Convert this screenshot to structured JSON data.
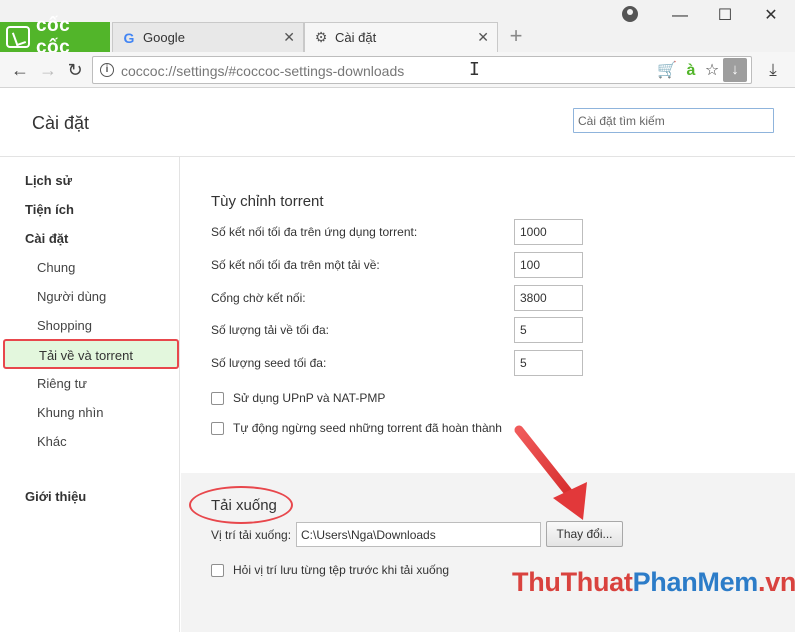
{
  "browser": {
    "brand": "cốc cốc",
    "tabs": [
      {
        "label": "Google",
        "icon": "google-icon"
      },
      {
        "label": "Cài đặt",
        "icon": "gear-icon"
      }
    ],
    "new_tab": "+",
    "window_controls": {
      "minimize": "—",
      "maximize": "☐",
      "close": "✕"
    },
    "address": "coccoc://settings/#coccoc-settings-downloads"
  },
  "settings": {
    "title": "Cài đặt",
    "search_placeholder": "Cài đặt tìm kiếm"
  },
  "sidebar": {
    "items": [
      {
        "label": "Lịch sử"
      },
      {
        "label": "Tiện ích"
      },
      {
        "label": "Cài đặt"
      },
      {
        "label": "Chung"
      },
      {
        "label": "Người dùng"
      },
      {
        "label": "Shopping"
      },
      {
        "label": "Tải về và torrent"
      },
      {
        "label": "Riêng tư"
      },
      {
        "label": "Khung nhìn"
      },
      {
        "label": "Khác"
      },
      {
        "label": "Giới thiệu"
      }
    ]
  },
  "torrent": {
    "title": "Tùy chỉnh torrent",
    "fields": [
      {
        "label": "Số kết nối tối đa trên ứng dụng torrent:",
        "value": "1000"
      },
      {
        "label": "Số kết nối tối đa trên một tải về:",
        "value": "100"
      },
      {
        "label": "Cổng chờ kết nối:",
        "value": "3800"
      },
      {
        "label": "Số lượng tải về tối đa:",
        "value": "5"
      },
      {
        "label": "Số lượng seed tối đa:",
        "value": "5"
      }
    ],
    "checkboxes": [
      {
        "label": "Sử dụng UPnP và NAT-PMP"
      },
      {
        "label": "Tự động ngừng seed những torrent đã hoàn thành"
      }
    ]
  },
  "downloads": {
    "title": "Tải xuống",
    "location_label": "Vị trí tải xuống:",
    "location_value": "C:\\Users\\Nga\\Downloads",
    "change_button": "Thay đổi...",
    "ask_checkbox": "Hỏi vị trí lưu từng tệp trước khi tải xuống"
  },
  "watermark": {
    "part1": "ThuThuat",
    "part2": "PhanMem",
    "part3": ".vn"
  },
  "colors": {
    "brand_green": "#52b52a",
    "highlight_red": "#e8474c",
    "active_bg": "#e3f7dd"
  }
}
